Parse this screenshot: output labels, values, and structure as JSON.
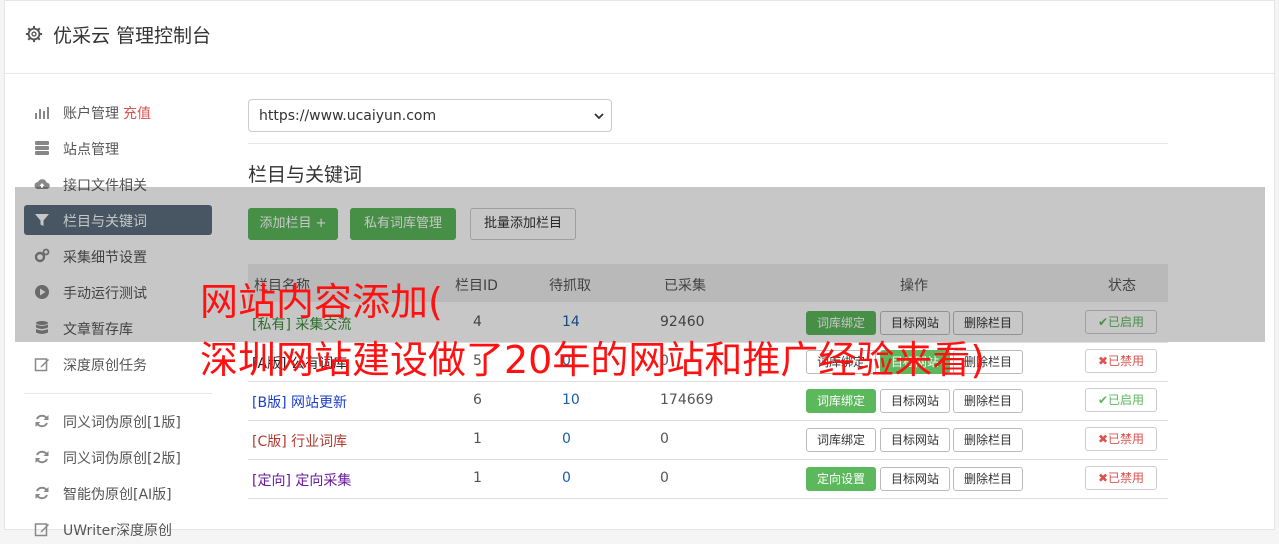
{
  "app": {
    "title": "优采云 管理控制台"
  },
  "sidebar": {
    "items": [
      {
        "label": "账户管理",
        "extra": "充值",
        "icon": "bar-chart-icon",
        "active": false
      },
      {
        "label": "站点管理",
        "icon": "server-icon",
        "active": false
      },
      {
        "label": "接口文件相关",
        "icon": "cloud-upload-icon",
        "active": false
      },
      {
        "label": "栏目与关键词",
        "icon": "filter-icon",
        "active": true
      },
      {
        "label": "采集细节设置",
        "icon": "cogs-icon",
        "active": false
      },
      {
        "label": "手动运行测试",
        "icon": "play-circle-icon",
        "active": false
      },
      {
        "label": "文章暂存库",
        "icon": "database-icon",
        "active": false
      },
      {
        "label": "深度原创任务",
        "icon": "edit-icon",
        "active": false
      },
      {
        "label": "同义词伪原创[1版]",
        "icon": "refresh-icon",
        "active": false
      },
      {
        "label": "同义词伪原创[2版]",
        "icon": "refresh-icon",
        "active": false
      },
      {
        "label": "智能伪原创[AI版]",
        "icon": "refresh-icon",
        "active": false
      },
      {
        "label": "UWriter深度原创",
        "icon": "edit-icon",
        "active": false
      }
    ]
  },
  "main": {
    "site_select": {
      "value": "https://www.ucaiyun.com"
    },
    "section_title": "栏目与关键词",
    "buttons": {
      "add_column": "添加栏目 +",
      "private_lib": "私有词库管理",
      "batch_add": "批量添加栏目"
    },
    "table": {
      "headers": [
        "栏目名称",
        "栏目ID",
        "待抓取",
        "已采集",
        "操作",
        "状态"
      ],
      "rows": [
        {
          "tag": "[私有]",
          "name": "采集交流",
          "id": "4",
          "pending": "14",
          "collected": "92460",
          "op1": "词库绑定",
          "op1_green": true,
          "op2": "目标网站",
          "op2_green": false,
          "op3": "删除栏目",
          "status": "已启用",
          "status_ok": true,
          "name_color": "#3c8d3c"
        },
        {
          "tag": "[A版]",
          "name": "公有词库",
          "id": "5",
          "pending": "0",
          "collected": "0",
          "op1": "词库绑定",
          "op1_green": false,
          "op2": "目标网站",
          "op2_green": true,
          "op3": "删除栏目",
          "status": "已禁用",
          "status_ok": false,
          "name_color": "#222222"
        },
        {
          "tag": "[B版]",
          "name": "网站更新",
          "id": "6",
          "pending": "10",
          "collected": "174669",
          "op1": "词库绑定",
          "op1_green": true,
          "op2": "目标网站",
          "op2_green": false,
          "op3": "删除栏目",
          "status": "已启用",
          "status_ok": true,
          "name_color": "#1a3fc7"
        },
        {
          "tag": "[C版]",
          "name": "行业词库",
          "id": "1",
          "pending": "0",
          "collected": "0",
          "op1": "词库绑定",
          "op1_green": false,
          "op2": "目标网站",
          "op2_green": false,
          "op3": "删除栏目",
          "status": "已禁用",
          "status_ok": false,
          "name_color": "#b03a2e"
        },
        {
          "tag": "[定向]",
          "name": "定向采集",
          "id": "1",
          "pending": "0",
          "collected": "0",
          "op1": "定向设置",
          "op1_green": true,
          "op2": "目标网站",
          "op2_green": false,
          "op3": "删除栏目",
          "status": "已禁用",
          "status_ok": false,
          "name_color": "#6a1b9a"
        }
      ]
    }
  },
  "overlay": {
    "line1": "网站内容添加(",
    "line2": "深圳网站建设做了20年的网站和推广经验来看)"
  },
  "colors": {
    "green": "#5cb85c",
    "active_sidebar": "#5c6f7e",
    "danger": "#d9534f",
    "link_blue": "#1a5ea8"
  }
}
